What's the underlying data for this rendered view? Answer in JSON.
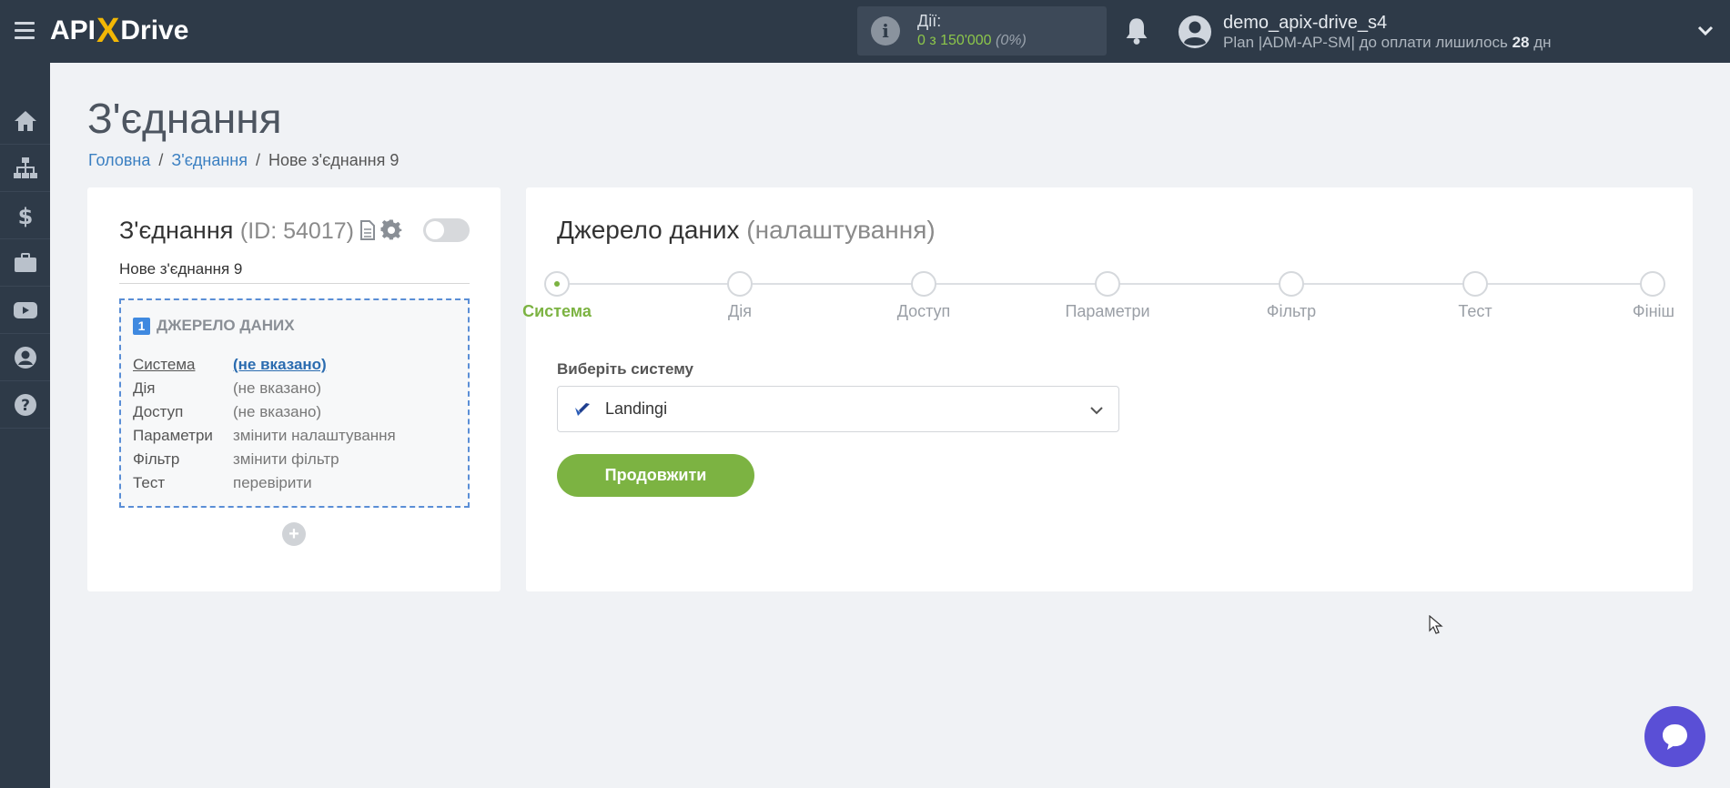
{
  "header": {
    "logo_api": "API",
    "logo_x": "X",
    "logo_drive": "Drive",
    "actions_label": "Дії:",
    "actions_value": "0 з 150'000",
    "actions_percent": "(0%)",
    "user_name": "demo_apix-drive_s4",
    "plan_text": "Plan |ADM-AP-SM| до оплати лишилось",
    "plan_days": "28",
    "plan_days_unit": "дн"
  },
  "sidebar": {
    "items": [
      "home-icon",
      "sitemap-icon",
      "dollar-icon",
      "briefcase-icon",
      "youtube-icon",
      "user-icon",
      "help-icon"
    ]
  },
  "page": {
    "title": "З'єднання",
    "breadcrumb": [
      "Головна",
      "З'єднання",
      "Нове з'єднання 9"
    ]
  },
  "connection": {
    "title": "З'єднання",
    "id_text": "(ID: 54017)",
    "name": "Нове з'єднання 9",
    "source": {
      "number": "1",
      "title": "ДЖЕРЕЛО ДАНИХ",
      "rows": [
        {
          "key": "Система",
          "value": "(не вказано)"
        },
        {
          "key": "Дія",
          "value": "(не вказано)"
        },
        {
          "key": "Доступ",
          "value": "(не вказано)"
        },
        {
          "key": "Параметри",
          "value": "змінити налаштування"
        },
        {
          "key": "Фільтр",
          "value": "змінити фільтр"
        },
        {
          "key": "Тест",
          "value": "перевірити"
        }
      ]
    },
    "add_label": "+"
  },
  "settings": {
    "title": "Джерело даних",
    "subtitle": "(налаштування)",
    "steps": [
      "Система",
      "Дія",
      "Доступ",
      "Параметри",
      "Фільтр",
      "Тест",
      "Фініш"
    ],
    "active_step": 0,
    "select_label": "Виберіть систему",
    "select_value": "Landingi",
    "continue_label": "Продовжити"
  },
  "colors": {
    "topbar": "#2e3a48",
    "accent_green": "#7cb342",
    "link_blue": "#3a7fc1",
    "chat_purple": "#5a4fd6"
  }
}
